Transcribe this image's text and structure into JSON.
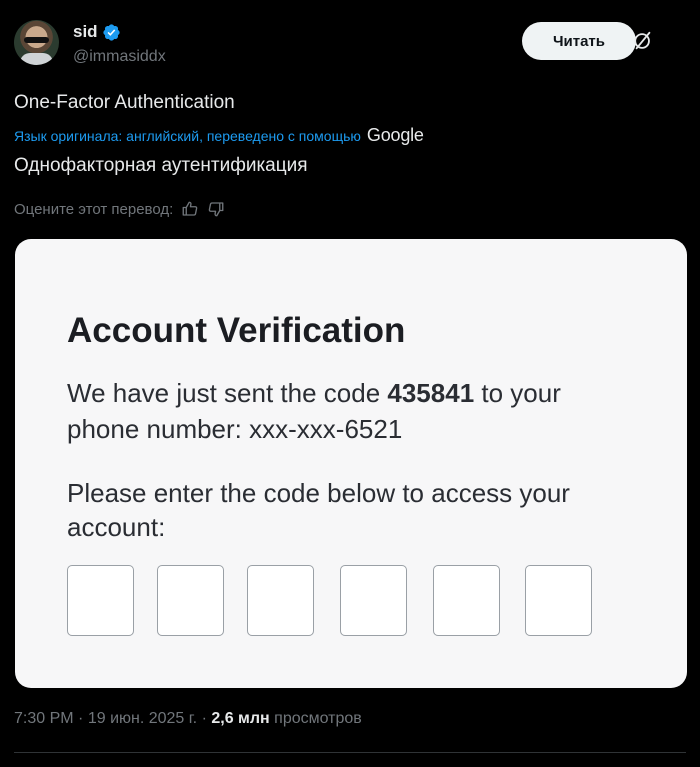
{
  "author": {
    "name": "sid",
    "handle": "@immasiddx"
  },
  "actions": {
    "read_label": "Читать"
  },
  "tweet": {
    "original_text": "One-Factor Authentication",
    "translation_note": "Язык оригинала: английский, переведено с помощью",
    "translation_provider": "Google",
    "translated_text": "Однофакторная аутентификация",
    "rate_label": "Оцените этот перевод:"
  },
  "card": {
    "title": "Account Verification",
    "line1_prefix": "We have just sent the code",
    "code": "435841",
    "line1_suffix": "to your phone number: xxx-xxx-6521",
    "line2": "Please enter the code below to access your account:",
    "code_box_count": 6
  },
  "meta": {
    "time": "7:30 PM",
    "sep1": "·",
    "date": "19 июн. 2025 г.",
    "sep2": "·",
    "views_count": "2,6 млн",
    "views_label": "просмотров"
  },
  "colors": {
    "background": "#000000",
    "link": "#1d9bf0",
    "verified": "#1d9bf0",
    "muted": "#71767b",
    "card_bg": "#f7f7f8"
  }
}
